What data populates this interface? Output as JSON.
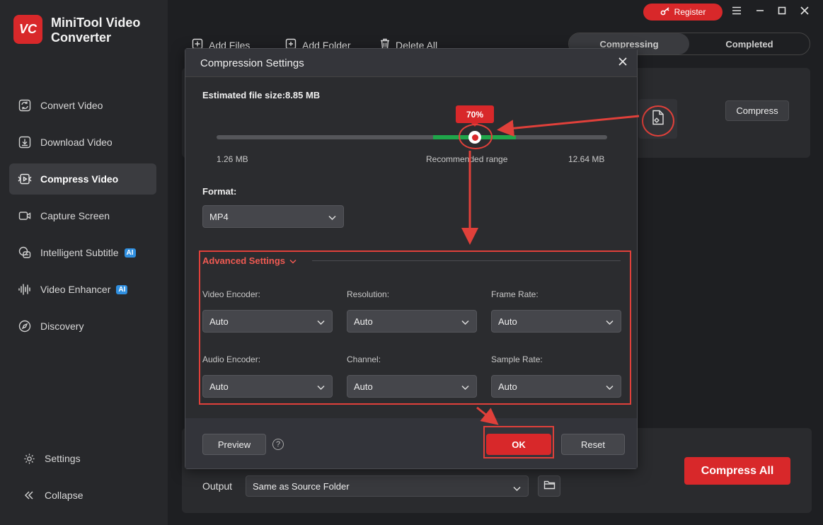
{
  "app": {
    "name": "MiniTool Video Converter",
    "logo_text": "VC"
  },
  "topbar": {
    "register_label": "Register",
    "icons": [
      "key-icon",
      "menu-icon",
      "minimize-icon",
      "maximize-icon",
      "close-icon"
    ]
  },
  "sidebar": {
    "items": [
      {
        "label": "Convert Video",
        "icon": "convert-icon"
      },
      {
        "label": "Download Video",
        "icon": "download-icon"
      },
      {
        "label": "Compress Video",
        "icon": "compress-icon",
        "active": true
      },
      {
        "label": "Capture Screen",
        "icon": "camera-icon"
      },
      {
        "label": "Intelligent Subtitle",
        "icon": "subtitle-icon",
        "badge": "AI"
      },
      {
        "label": "Video Enhancer",
        "icon": "waveform-icon",
        "badge": "AI"
      },
      {
        "label": "Discovery",
        "icon": "compass-icon"
      }
    ],
    "settings_label": "Settings",
    "collapse_label": "Collapse"
  },
  "toolbar": {
    "add_files": "Add Files",
    "add_folder": "Add Folder",
    "delete_all": "Delete All"
  },
  "tabs": {
    "compressing": "Compressing",
    "completed": "Completed"
  },
  "task": {
    "compress_label": "Compress"
  },
  "bottom": {
    "output_label": "Output",
    "output_value": "Same as Source Folder",
    "compress_all_label": "Compress All"
  },
  "dialog": {
    "title": "Compression Settings",
    "estimated_label": "Estimated file size:8.85 MB",
    "slider": {
      "percent_label": "70%",
      "value_percent": 70,
      "min_label": "1.26 MB",
      "max_label": "12.64 MB",
      "recommended_label": "Recommended range"
    },
    "format_label": "Format:",
    "format_value": "MP4",
    "advanced_label": "Advanced Settings",
    "fields": {
      "video_encoder": {
        "label": "Video Encoder:",
        "value": "Auto"
      },
      "resolution": {
        "label": "Resolution:",
        "value": "Auto"
      },
      "frame_rate": {
        "label": "Frame Rate:",
        "value": "Auto"
      },
      "audio_encoder": {
        "label": "Audio Encoder:",
        "value": "Auto"
      },
      "channel": {
        "label": "Channel:",
        "value": "Auto"
      },
      "sample_rate": {
        "label": "Sample Rate:",
        "value": "Auto"
      }
    },
    "preview_label": "Preview",
    "help_label": "?",
    "ok_label": "OK",
    "reset_label": "Reset"
  },
  "colors": {
    "accent": "#d8282a",
    "recommended": "#1fa64a",
    "annotation": "#e0403a",
    "ai_badge": "#2f8fe0"
  }
}
